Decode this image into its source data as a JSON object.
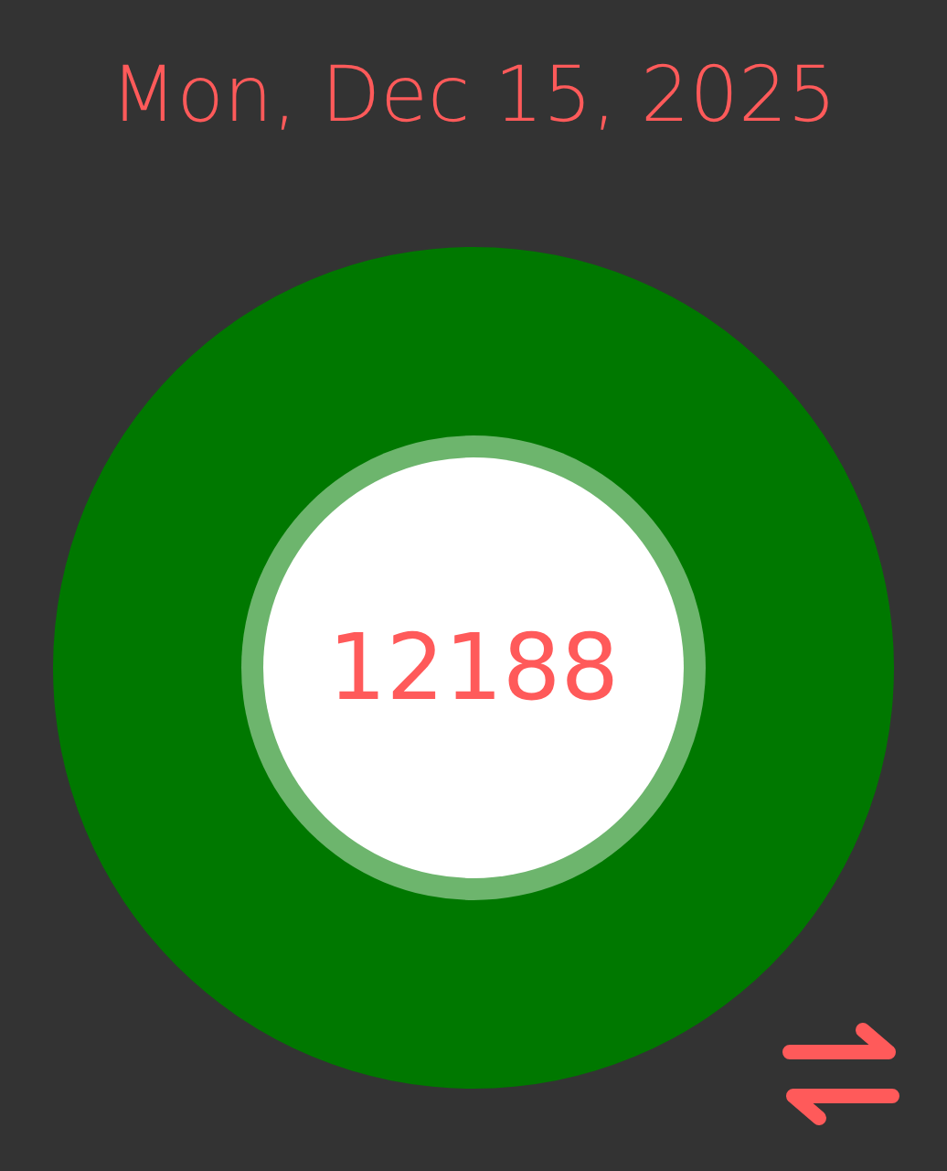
{
  "date": "Mon, Dec 15, 2025",
  "steps": "12188"
}
